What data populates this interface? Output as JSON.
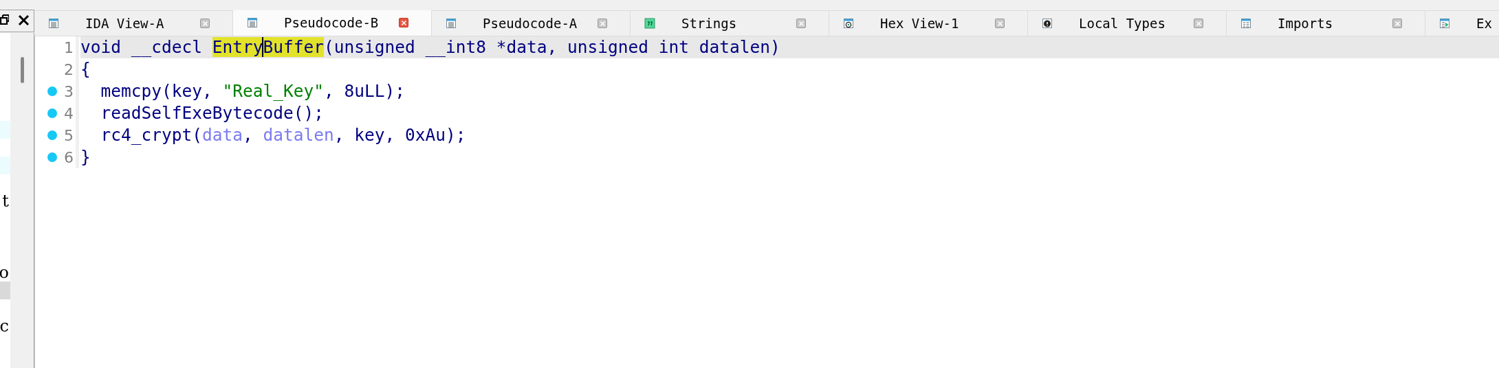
{
  "left_panel": {
    "rows": [
      {
        "kind": "match"
      },
      {
        "kind": "match"
      },
      {
        "kind": "text",
        "text": "t"
      },
      {
        "kind": "text",
        "text": "o"
      },
      {
        "kind": "selected"
      },
      {
        "kind": "text",
        "text": "c"
      }
    ]
  },
  "tabs": [
    {
      "label": "IDA View-A",
      "kind": "listing",
      "selected": false,
      "closable": true
    },
    {
      "label": "Pseudocode-B",
      "kind": "listing",
      "selected": true,
      "closable": true
    },
    {
      "label": "Pseudocode-A",
      "kind": "listing",
      "selected": false,
      "closable": true
    },
    {
      "label": "Strings",
      "kind": "strings",
      "selected": false,
      "closable": true
    },
    {
      "label": "Hex View-1",
      "kind": "hex",
      "selected": false,
      "closable": true
    },
    {
      "label": "Local Types",
      "kind": "types",
      "selected": false,
      "closable": true
    },
    {
      "label": "Imports",
      "kind": "imports",
      "selected": false,
      "closable": true
    },
    {
      "label": "Ex",
      "kind": "exports",
      "selected": false,
      "closable": false
    }
  ],
  "code": {
    "lines": [
      {
        "number": "1",
        "current": true,
        "breakpoint": false,
        "tokens": [
          {
            "text": "void __cdecl ",
            "kind": "plain"
          },
          {
            "text": "Entry",
            "kind": "highlight",
            "caret_after": true
          },
          {
            "text": "Buffer",
            "kind": "highlight"
          },
          {
            "text": "(unsigned __int8 *data, unsigned int datalen)",
            "kind": "plain"
          }
        ]
      },
      {
        "number": "2",
        "current": false,
        "breakpoint": false,
        "tokens": [
          {
            "text": "{",
            "kind": "plain"
          }
        ]
      },
      {
        "number": "3",
        "current": false,
        "breakpoint": true,
        "tokens": [
          {
            "text": "  memcpy(key, ",
            "kind": "plain"
          },
          {
            "text": "\"Real_Key\"",
            "kind": "string"
          },
          {
            "text": ", 8uLL);",
            "kind": "plain"
          }
        ]
      },
      {
        "number": "4",
        "current": false,
        "breakpoint": true,
        "tokens": [
          {
            "text": "  readSelfExeBytecode();",
            "kind": "plain"
          }
        ]
      },
      {
        "number": "5",
        "current": false,
        "breakpoint": true,
        "tokens": [
          {
            "text": "  rc4_crypt(",
            "kind": "plain"
          },
          {
            "text": "data",
            "kind": "variable"
          },
          {
            "text": ", ",
            "kind": "plain"
          },
          {
            "text": "datalen",
            "kind": "variable"
          },
          {
            "text": ", key, 0xAu);",
            "kind": "plain"
          }
        ]
      },
      {
        "number": "6",
        "current": false,
        "breakpoint": true,
        "tokens": [
          {
            "text": "}",
            "kind": "plain"
          }
        ]
      }
    ]
  }
}
